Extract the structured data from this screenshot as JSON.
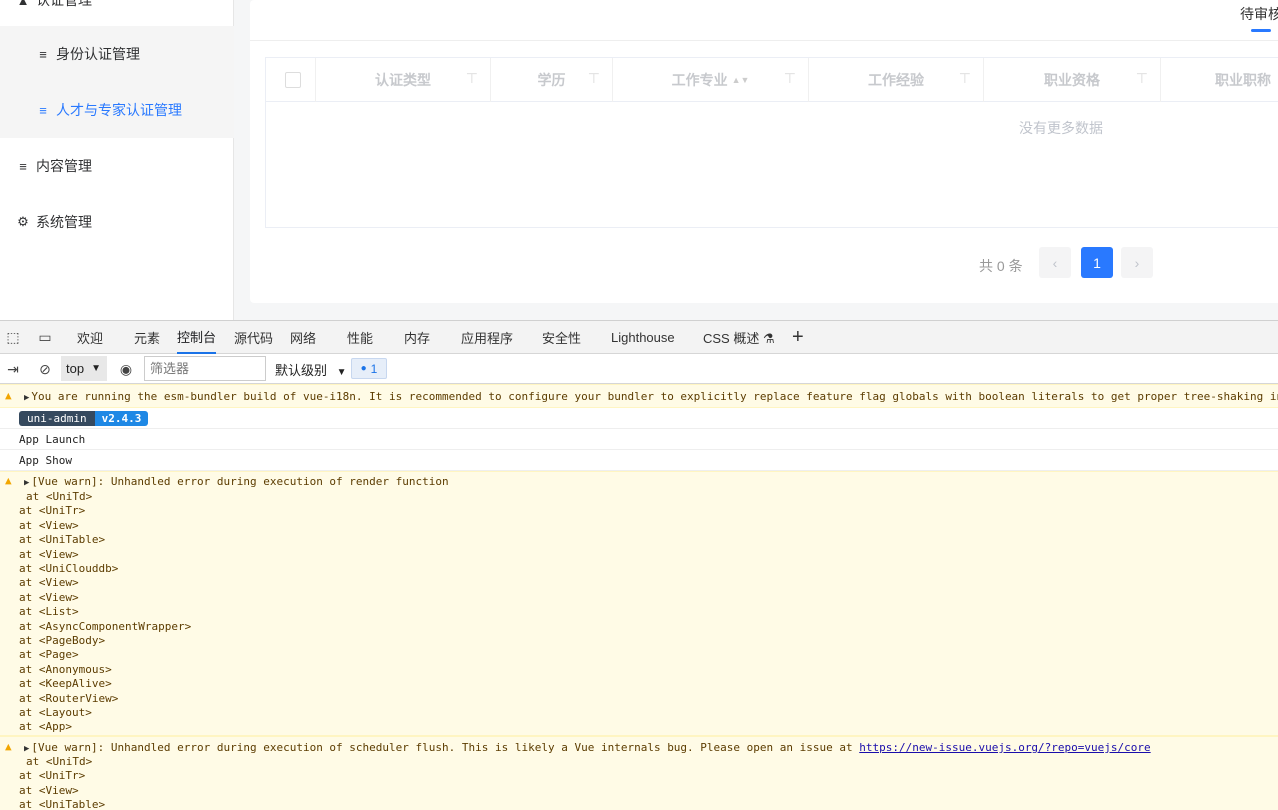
{
  "sidebar": {
    "items": [
      {
        "label": "认证管理",
        "icon": "user-icon"
      },
      {
        "label": "身份认证管理",
        "icon": "menu-icon"
      },
      {
        "label": "人才与专家认证管理",
        "icon": "menu-icon"
      },
      {
        "label": "内容管理",
        "icon": "menu-icon"
      },
      {
        "label": "系统管理",
        "icon": "gear-icon"
      }
    ]
  },
  "main": {
    "tab_label": "待审核",
    "table": {
      "columns": [
        "认证类型",
        "学历",
        "工作专业",
        "工作经验",
        "职业资格",
        "职业职称"
      ],
      "empty_text": "没有更多数据"
    },
    "pagination": {
      "total_text": "共 0 条",
      "current_page": "1",
      "prev": "‹",
      "next": "›"
    }
  },
  "devtools": {
    "tabs": [
      "欢迎",
      "元素",
      "控制台",
      "源代码",
      "网络",
      "性能",
      "内存",
      "应用程序",
      "安全性",
      "Lighthouse",
      "CSS 概述 ⚗"
    ],
    "active_tab": "控制台",
    "add_tab": "+",
    "toolbar": {
      "context": "top",
      "filter_placeholder": "筛选器",
      "level": "默认级别",
      "issues_count": "1"
    },
    "console": {
      "msg1": "You are running the esm-bundler build of vue-i18n. It is recommended to configure your bundler to explicitly replace feature flag globals with boolean literals to get proper tree-shaking in",
      "badge_name": "uni-admin",
      "badge_version": "v2.4.3",
      "log1": "App Launch",
      "log2": "App Show",
      "warn1": "[Vue warn]: Unhandled error during execution of render function",
      "stack1": [
        "at <UniTd>",
        "at <UniTr>",
        "at <View>",
        "at <UniTable>",
        "at <View>",
        "at <UniClouddb>",
        "at <View>",
        "at <View>",
        "at <List>",
        "at <AsyncComponentWrapper>",
        "at <PageBody>",
        "at <Page>",
        "at <Anonymous>",
        "at <KeepAlive>",
        "at <RouterView>",
        "at <Layout>",
        "at <App>"
      ],
      "warn2": "[Vue warn]: Unhandled error during execution of scheduler flush. This is likely a Vue internals bug. Please open an issue at ",
      "warn2_link": "https://new-issue.vuejs.org/?repo=vuejs/core",
      "stack2": [
        "at <UniTd>",
        "at <UniTr>",
        "at <View>",
        "at <UniTable>"
      ]
    }
  }
}
